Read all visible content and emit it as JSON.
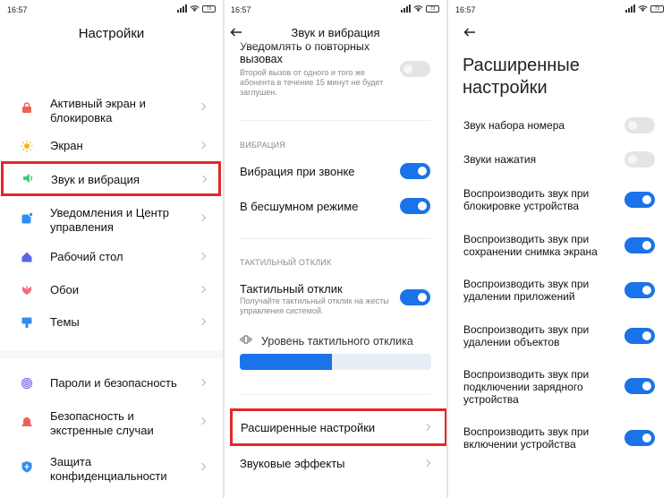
{
  "screen1": {
    "time": "16:57",
    "battery": "73",
    "title": "Настройки",
    "items": [
      {
        "label": "Активный экран и блокировка",
        "icon": "lock-icon",
        "color": "#f0605b"
      },
      {
        "label": "Экран",
        "icon": "sun-icon",
        "color": "#f5b323"
      },
      {
        "label": "Звук и вибрация",
        "icon": "speaker-icon",
        "color": "#3dcc7a"
      },
      {
        "label": "Уведомления и Центр управления",
        "icon": "notification-icon",
        "color": "#2f8ef0"
      },
      {
        "label": "Рабочий стол",
        "icon": "home-icon",
        "color": "#5a67e8"
      },
      {
        "label": "Обои",
        "icon": "flower-icon",
        "color": "#f06b86"
      },
      {
        "label": "Темы",
        "icon": "theme-icon",
        "color": "#2f8ef0"
      },
      {
        "label": "Пароли и безопасность",
        "icon": "fingerprint-icon",
        "color": "#8a6af0"
      },
      {
        "label": "Безопасность и экстренные случаи",
        "icon": "sos-icon",
        "color": "#f0605b"
      },
      {
        "label": "Защита конфиденциальности",
        "icon": "privacy-icon",
        "color": "#2f8ef0"
      }
    ]
  },
  "screen2": {
    "time": "16:57",
    "battery": "73",
    "title": "Звук и вибрация",
    "repeat_calls": {
      "title": "Уведомлять о повторных вызовах",
      "desc": "Второй вызов от одного и того же абонента в течение 15 минут не будет заглушен.",
      "on": false
    },
    "vibration_section": "ВИБРАЦИЯ",
    "vibrate_call": {
      "label": "Вибрация при звонке",
      "on": true
    },
    "vibrate_silent": {
      "label": "В бесшумном режиме",
      "on": true
    },
    "haptic_section": "ТАКТИЛЬНЫЙ ОТКЛИК",
    "haptic": {
      "label": "Тактильный отклик",
      "desc": "Получайте тактильный отклик на жесты управления системой.",
      "on": true
    },
    "haptic_level": {
      "label": "Уровень тактильного отклика",
      "value": 0.48
    },
    "advanced": "Расширенные настройки",
    "sound_effects": "Звуковые эффекты"
  },
  "screen3": {
    "time": "16:57",
    "battery": "73",
    "title_line1": "Расширенные",
    "title_line2": "настройки",
    "toggles": [
      {
        "lines": [
          "Звук набора номера"
        ],
        "on": false
      },
      {
        "lines": [
          "Звуки нажатия"
        ],
        "on": false
      },
      {
        "lines": [
          "Воспроизводить звук при",
          "блокировке устройства"
        ],
        "on": true
      },
      {
        "lines": [
          "Воспроизводить звук при",
          "сохранении снимка экрана"
        ],
        "on": true
      },
      {
        "lines": [
          "Воспроизводить звук при",
          "удалении приложений"
        ],
        "on": true
      },
      {
        "lines": [
          "Воспроизводить звук при",
          "удалении объектов"
        ],
        "on": true
      },
      {
        "lines": [
          "Воспроизводить звук при",
          "подключении зарядного",
          "устройства"
        ],
        "on": true
      },
      {
        "lines": [
          "Воспроизводить звук при",
          "включении устройства"
        ],
        "on": true
      }
    ]
  },
  "colors": {
    "accent": "#1a73e8",
    "highlight": "#e4262c"
  }
}
